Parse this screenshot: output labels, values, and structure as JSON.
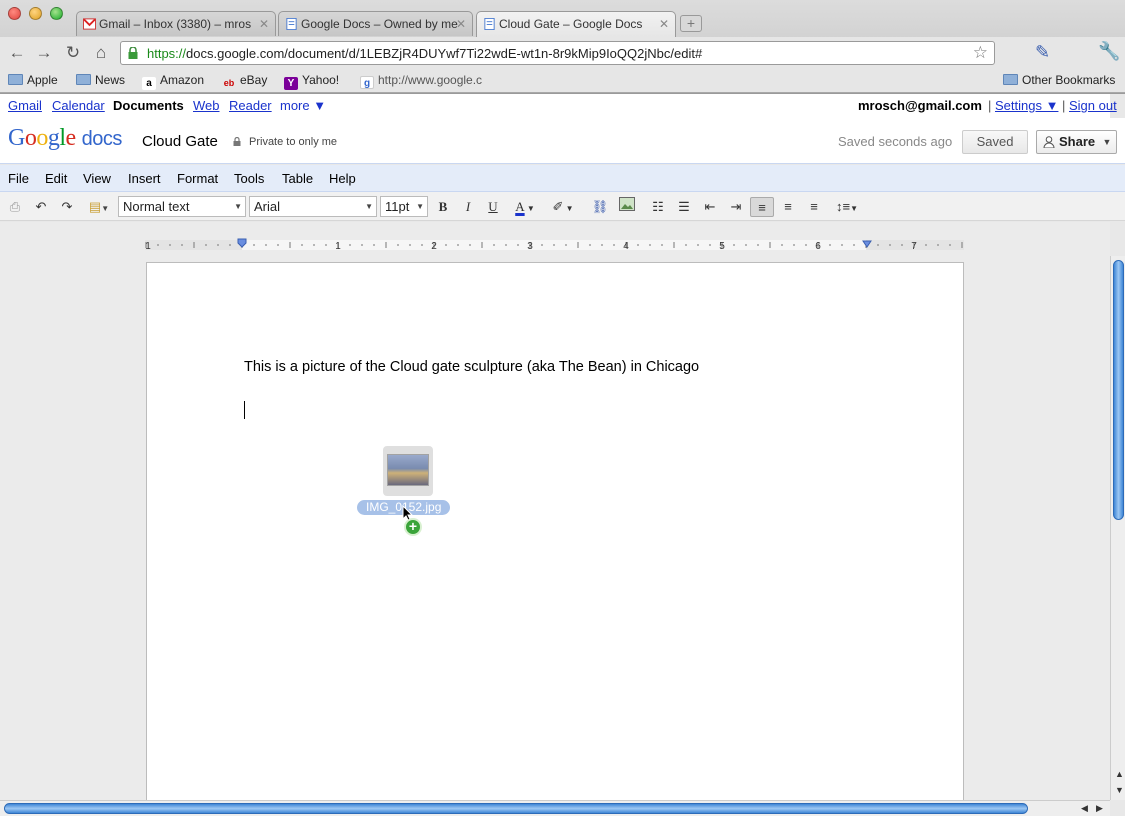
{
  "browser": {
    "tabs": [
      {
        "label": "Gmail – Inbox (3380) – mros",
        "icon": "gmail-icon"
      },
      {
        "label": "Google Docs – Owned by me",
        "icon": "docs-icon"
      },
      {
        "label": "Cloud Gate – Google Docs",
        "icon": "docs-icon",
        "active": true
      }
    ],
    "url_scheme": "https://",
    "url_rest": "docs.google.com/document/d/1LEBZjR4DUYwf7Ti22wdE-wt1n-8r9kMip9IoQQ2jNbc/edit#",
    "bookmarks": [
      {
        "label": "Apple",
        "icon": "folder-icon"
      },
      {
        "label": "News",
        "icon": "folder-icon"
      },
      {
        "label": "Amazon",
        "icon": "amazon-icon"
      },
      {
        "label": "eBay",
        "icon": "ebay-icon"
      },
      {
        "label": "Yahoo!",
        "icon": "yahoo-icon"
      },
      {
        "label": "http://www.google.c",
        "icon": "google-icon"
      }
    ],
    "other_bookmarks": "Other Bookmarks"
  },
  "gbar": {
    "links": [
      "Gmail",
      "Calendar",
      "Documents",
      "Web",
      "Reader",
      "more ▼"
    ],
    "current": "Documents",
    "email": "mrosch@gmail.com",
    "settings": "Settings ▼",
    "signout": "Sign out",
    "separator": "|"
  },
  "header": {
    "logo_google": "Google",
    "logo_docs": "docs",
    "title": "Cloud Gate",
    "privacy": "Private to only me",
    "save_status": "Saved seconds ago",
    "saved_button": "Saved",
    "share_button": "Share"
  },
  "menu": [
    "File",
    "Edit",
    "View",
    "Insert",
    "Format",
    "Tools",
    "Table",
    "Help"
  ],
  "toolbar": {
    "style": "Normal text",
    "font": "Arial",
    "size": "11pt",
    "bold": "B",
    "italic": "I",
    "underline": "U",
    "text_color": "A"
  },
  "ruler": {
    "numbers": [
      "1",
      "1",
      "2",
      "3",
      "4",
      "5",
      "6",
      "7"
    ]
  },
  "document": {
    "text": "This is a picture of the Cloud gate sculpture (aka The Bean) in Chicago"
  },
  "drag": {
    "filename": "IMG_0152.jpg",
    "plus": "+"
  },
  "colors": {
    "link": "#1a33cc",
    "menubar": "#e4ecf9",
    "scroll_thumb": "#3f86d6"
  }
}
